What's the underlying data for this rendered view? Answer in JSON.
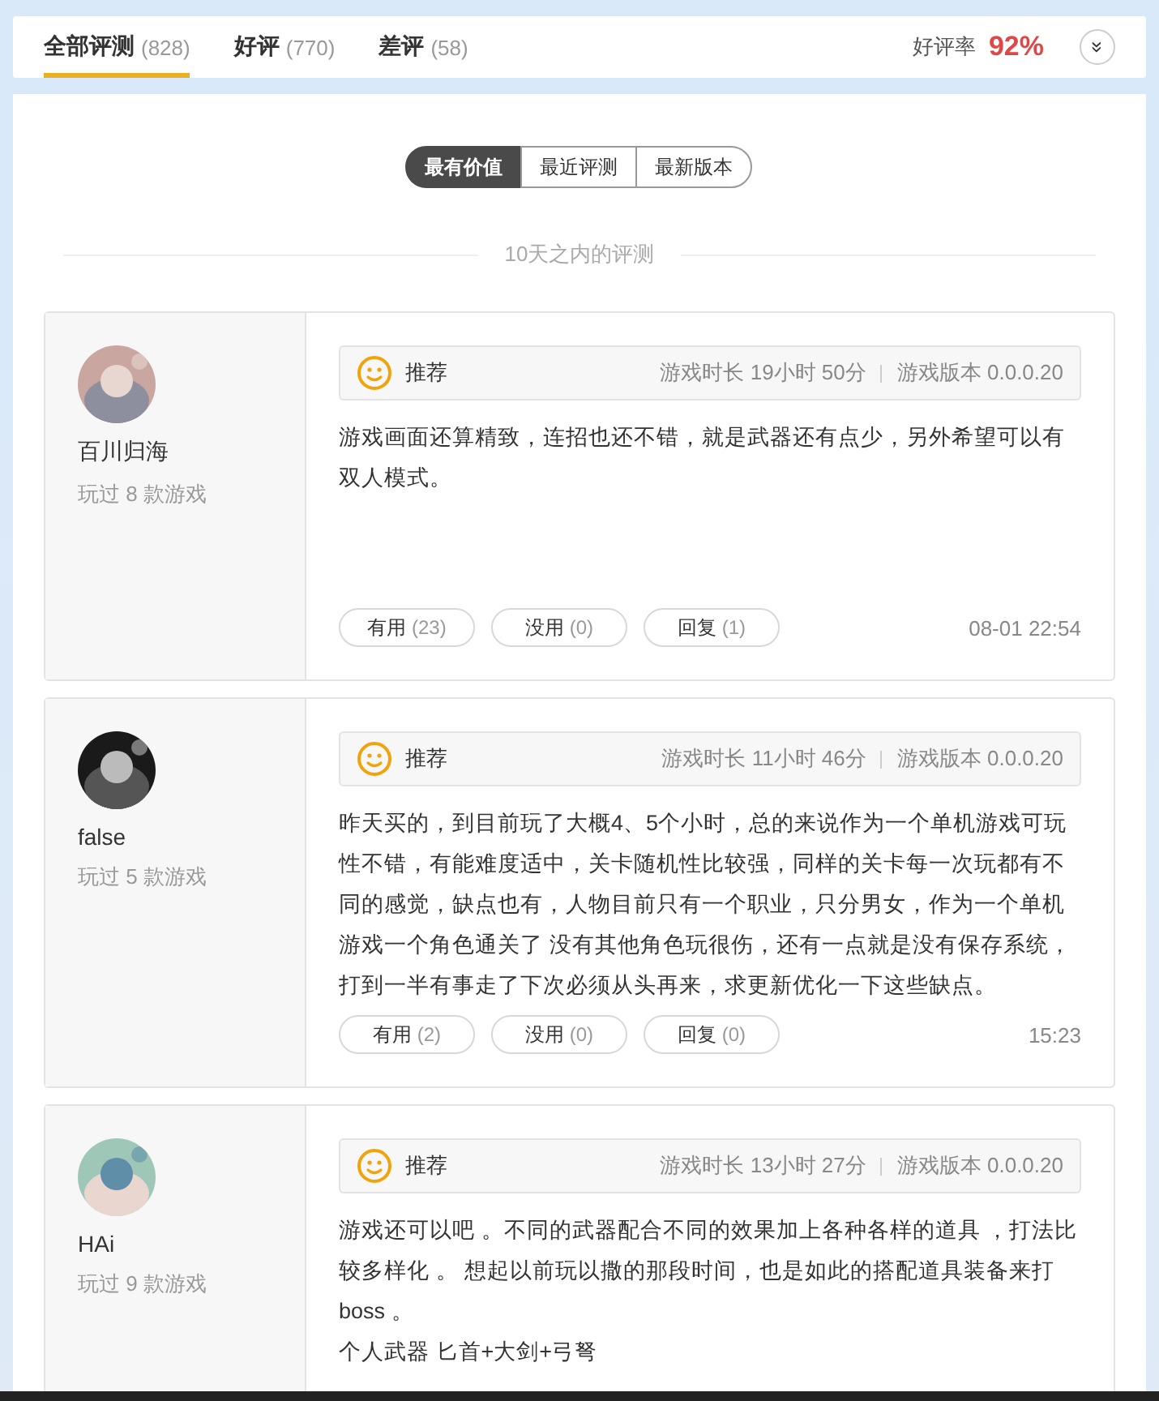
{
  "tabs": [
    {
      "label": "全部评测",
      "count": "(828)",
      "selected": true
    },
    {
      "label": "好评",
      "count": "(770)",
      "selected": false
    },
    {
      "label": "差评",
      "count": "(58)",
      "selected": false
    }
  ],
  "rating": {
    "label": "好评率",
    "value": "92%",
    "expand_icon": "»"
  },
  "sort_options": [
    {
      "label": "最有价值",
      "selected": true
    },
    {
      "label": "最近评测",
      "selected": false
    },
    {
      "label": "最新版本",
      "selected": false
    }
  ],
  "section_title": "10天之内的评测",
  "reviews": [
    {
      "avatar": {
        "kind": "picture"
      },
      "user": "百川归海",
      "games": "玩过 8 款游戏",
      "verdict": "推荐",
      "playtime": "游戏时长 19小时 50分",
      "version": "游戏版本 0.0.0.20",
      "body": [
        "游戏画面还算精致，连招也还不错，就是武器还有点少，另外希望可以有双人模式。"
      ],
      "actions": [
        {
          "label": "有用",
          "count": "(23)"
        },
        {
          "label": "没用",
          "count": "(0)"
        },
        {
          "label": "回复",
          "count": "(1)"
        }
      ],
      "time": "08-01 22:54"
    },
    {
      "avatar": {
        "kind": "picture"
      },
      "user": "false",
      "games": "玩过 5 款游戏",
      "verdict": "推荐",
      "playtime": "游戏时长 11小时 46分",
      "version": "游戏版本 0.0.0.20",
      "body": [
        "昨天买的，到目前玩了大概4、5个小时，总的来说作为一个单机游戏可玩性不错，有能难度适中，关卡随机性比较强，同样的关卡每一次玩都有不同的感觉，缺点也有，人物目前只有一个职业，只分男女，作为一个单机游戏一个角色通关了 没有其他角色玩很伤，还有一点就是没有保存系统，打到一半有事走了下次必须从头再来，求更新优化一下这些缺点。"
      ],
      "actions": [
        {
          "label": "有用",
          "count": "(2)"
        },
        {
          "label": "没用",
          "count": "(0)"
        },
        {
          "label": "回复",
          "count": "(0)"
        }
      ],
      "time": "15:23"
    },
    {
      "avatar": {
        "kind": "picture"
      },
      "user": "HAi",
      "games": "玩过 9 款游戏",
      "verdict": "推荐",
      "playtime": "游戏时长 13小时 27分",
      "version": "游戏版本 0.0.0.20",
      "body": [
        "游戏还可以吧 。不同的武器配合不同的效果加上各种各样的道具 ，打法比较多样化 。 想起以前玩以撒的那段时间，也是如此的搭配道具装备来打boss 。",
        "个人武器 匕首+大剑+弓弩"
      ]
    }
  ]
}
